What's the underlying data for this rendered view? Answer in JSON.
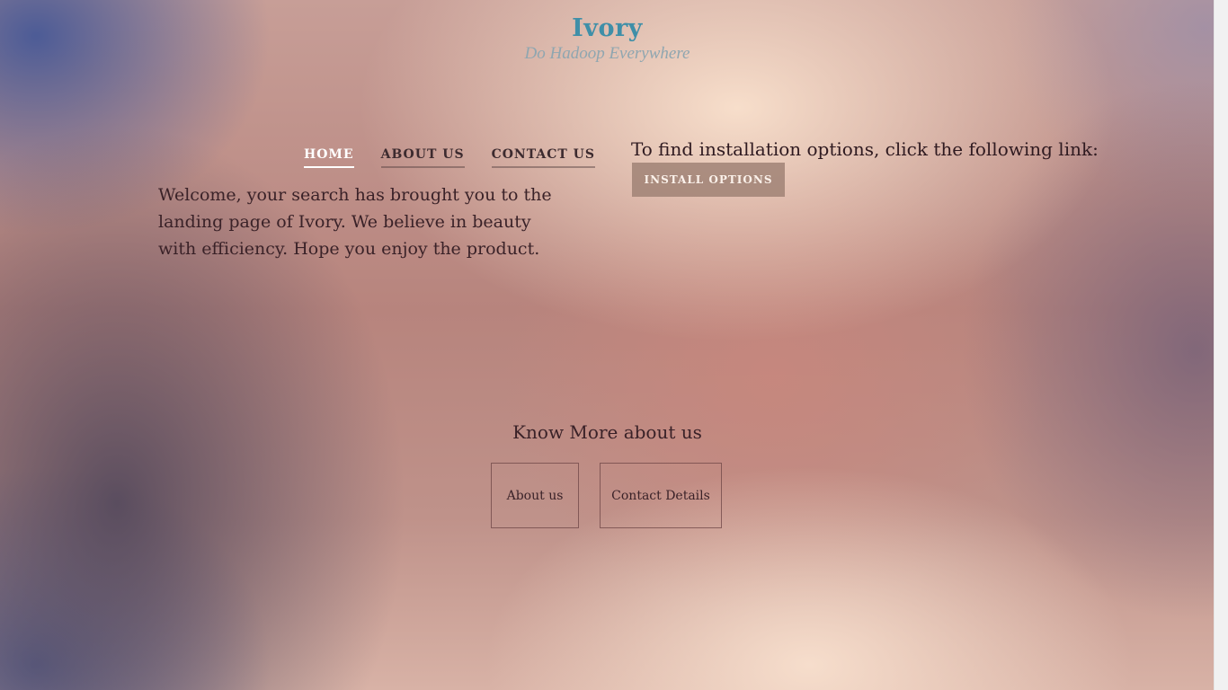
{
  "site": {
    "title": "Ivory",
    "tagline": "Do Hadoop Everywhere"
  },
  "nav": {
    "items": [
      {
        "label": "HOME",
        "active": true
      },
      {
        "label": "ABOUT US",
        "active": false
      },
      {
        "label": "CONTACT US",
        "active": false
      }
    ]
  },
  "main": {
    "welcome_text": "Welcome, your search has brought you to the landing page of Ivory. We believe in beauty with efficiency. Hope you enjoy the product.",
    "install_prompt": "To find installation options, click the following link:",
    "install_button": "INSTALL OPTIONS"
  },
  "know_more": {
    "heading": "Know More about us",
    "about_button": "About us",
    "contact_button": "Contact Details"
  },
  "colors": {
    "title": "#3f8fa8",
    "tagline": "#8fa6b0",
    "nav_active": "#ffffff",
    "body_text": "#3a2228"
  }
}
